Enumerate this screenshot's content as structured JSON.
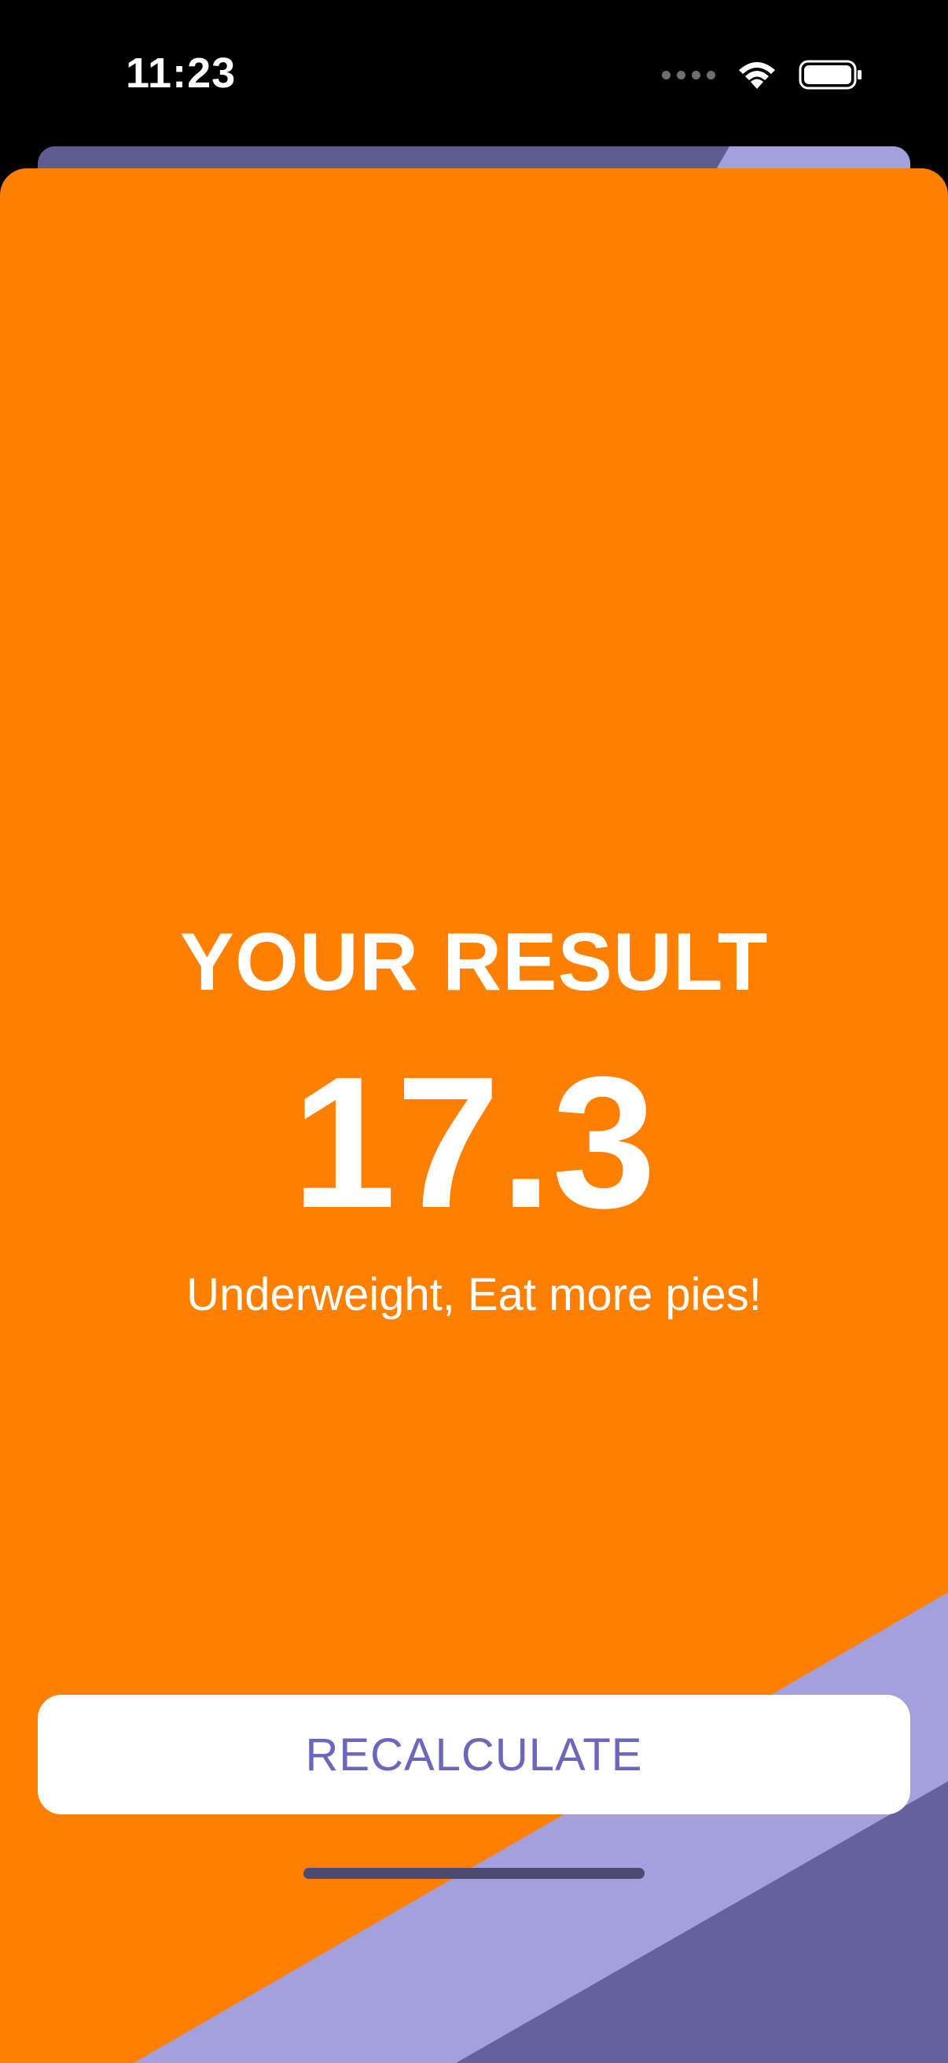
{
  "status_bar": {
    "time": "11:23",
    "icons": [
      "cellular-dots-icon",
      "wifi-icon",
      "battery-icon"
    ]
  },
  "result": {
    "title": "YOUR RESULT",
    "bmi_value": "17.3",
    "advice": "Underweight, Eat more pies!"
  },
  "actions": {
    "recalculate_label": "RECALCULATE"
  },
  "colors": {
    "background": "#ff7f00",
    "accent_light_purple": "#a3a0dd",
    "accent_dark_purple": "#5e5b93",
    "button_text": "#6b67bd",
    "text": "#ffffff"
  }
}
